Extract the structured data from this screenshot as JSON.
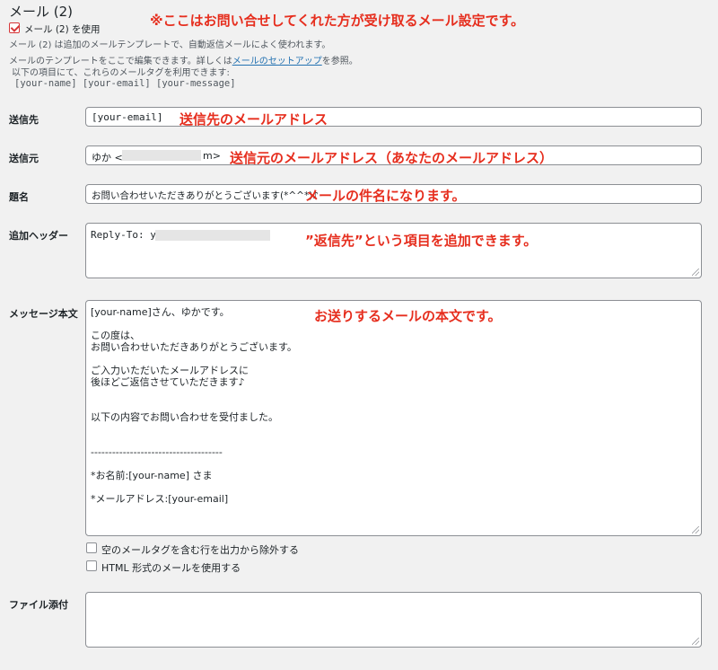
{
  "section": {
    "title": "メール (2)",
    "use_checkbox_label": "メール (2) を使用",
    "use_checkbox_checked": true,
    "description": "メール (2) は追加のメールテンプレートで、自動返信メールによく使われます。",
    "help_before": "メールのテンプレートをここで編集できます。詳しくは",
    "help_link": "メールのセットアップ",
    "help_after": "を参照。",
    "tags_intro": "以下の項目にて、これらのメールタグを利用できます:",
    "tags": "[your-name] [your-email] [your-message]"
  },
  "annotations": {
    "top": "※ここはお問い合せしてくれた方が受け取るメール設定です。",
    "to": "送信先のメールアドレス",
    "from": "送信元のメールアドレス（あなたのメールアドレス）",
    "subject": "メールの件名になります。",
    "headers": "”返信先”という項目を追加できます。",
    "body": "お送りするメールの本文です。"
  },
  "form": {
    "to_label": "送信先",
    "to_value": "[your-email]",
    "from_label": "送信元",
    "from_value_prefix": "ゆか <",
    "from_value_suffix": "m>",
    "subject_label": "題名",
    "subject_value": "お問い合わせいただきありがとうございます(*^^*)♪",
    "headers_label": "追加ヘッダー",
    "headers_value_prefix": "Reply-To: y",
    "body_label": "メッセージ本文",
    "body_lines": [
      "[your-name]さん、ゆかです。",
      "",
      "この度は、",
      "お問い合わせいただきありがとうございます。",
      "",
      "ご入力いただいたメールアドレスに",
      "後ほどご返信させていただきます♪",
      "",
      "",
      "以下の内容でお問い合わせを受付ました。",
      "",
      "",
      "-------------------------------------",
      "",
      "*お名前:[your-name] さま",
      "",
      "*メールアドレス:[your-email]"
    ],
    "exclude_blank_label": "空のメールタグを含む行を出力から除外する",
    "exclude_blank_checked": false,
    "html_label": "HTML 形式のメールを使用する",
    "html_checked": false,
    "attachments_label": "ファイル添付",
    "attachments_value": ""
  }
}
